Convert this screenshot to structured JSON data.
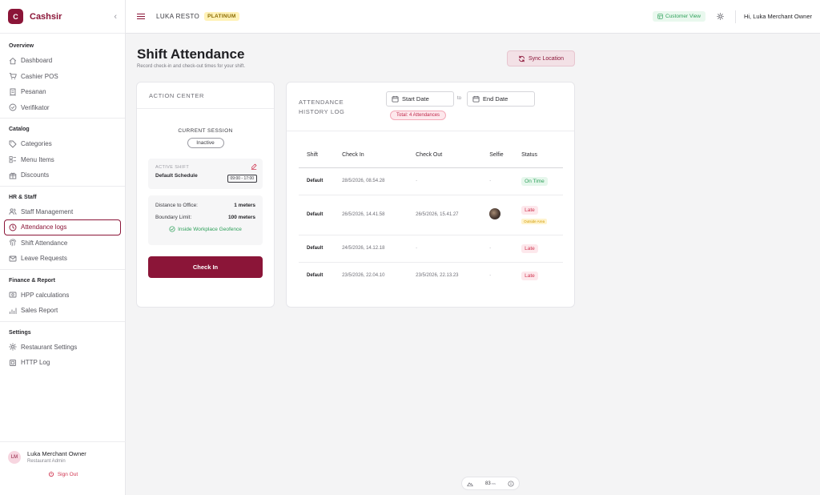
{
  "brand": {
    "logo_letter": "C",
    "name": "Cashsir"
  },
  "sidebar": {
    "sections": [
      {
        "title": "Overview",
        "items": [
          {
            "label": "Dashboard",
            "icon": "home-icon"
          },
          {
            "label": "Cashier POS",
            "icon": "cart-icon"
          },
          {
            "label": "Pesanan",
            "icon": "receipt-icon"
          },
          {
            "label": "Verifikator",
            "icon": "check-circle-icon"
          }
        ]
      },
      {
        "title": "Catalog",
        "items": [
          {
            "label": "Categories",
            "icon": "tag-icon"
          },
          {
            "label": "Menu Items",
            "icon": "menu-icon"
          },
          {
            "label": "Discounts",
            "icon": "gift-icon"
          }
        ]
      },
      {
        "title": "HR & Staff",
        "items": [
          {
            "label": "Staff Management",
            "icon": "users-icon"
          },
          {
            "label": "Attendance logs",
            "icon": "clock-icon",
            "active": true
          },
          {
            "label": "Shift Attendance",
            "icon": "fingerprint-icon"
          },
          {
            "label": "Leave Requests",
            "icon": "mail-icon"
          }
        ]
      },
      {
        "title": "Finance & Report",
        "items": [
          {
            "label": "HPP calculations",
            "icon": "calculator-icon"
          },
          {
            "label": "Sales Report",
            "icon": "bar-chart-icon"
          }
        ]
      },
      {
        "title": "Settings",
        "items": [
          {
            "label": "Restaurant Settings",
            "icon": "gear-icon"
          },
          {
            "label": "HTTP Log",
            "icon": "chip-icon"
          }
        ]
      }
    ],
    "user": {
      "initials": "LM",
      "name": "Luka Merchant Owner",
      "role": "Restaurant Admin"
    },
    "sign_out": "Sign Out"
  },
  "topbar": {
    "restaurant": "LUKA RESTO",
    "tier": "PLATINUM",
    "customer_view": "Customer View",
    "greeting": "Hi, Luka Merchant Owner"
  },
  "page": {
    "title": "Shift Attendance",
    "subtitle": "Record check-in and check-out times for your shift.",
    "sync_button": "Sync Location"
  },
  "action_center": {
    "title": "ACTION CENTER",
    "session_label": "CURRENT SESSION",
    "session_status": "Inactive",
    "active_shift_label": "ACTIVE SHIFT",
    "shift_name": "Default Schedule",
    "shift_time": "09:00 - 17:00",
    "distance_label": "Distance to Office:",
    "distance_value": "1 meters",
    "boundary_label": "Boundary Limit:",
    "boundary_value": "100 meters",
    "geofence_status": "Inside Workplace Geofence",
    "checkin_button": "Check In"
  },
  "history": {
    "title": "ATTENDANCE HISTORY LOG",
    "start_date": "Start Date",
    "to": "to",
    "end_date": "End Date",
    "total": "Total: 4 Attendances",
    "columns": [
      "Shift",
      "Check In",
      "Check Out",
      "Selfie",
      "Status"
    ],
    "rows": [
      {
        "shift": "Default",
        "check_in": "28/5/2026, 08.54.28",
        "check_out": "-",
        "selfie": "-",
        "status": "On Time",
        "note": ""
      },
      {
        "shift": "Default",
        "check_in": "26/5/2026, 14.41.58",
        "check_out": "26/5/2026, 15.41.27",
        "selfie": "photo",
        "status": "Late",
        "note": "Outside Area"
      },
      {
        "shift": "Default",
        "check_in": "24/5/2026, 14.12.18",
        "check_out": "-",
        "selfie": "-",
        "status": "Late",
        "note": ""
      },
      {
        "shift": "Default",
        "check_in": "23/5/2026, 22.04.10",
        "check_out": "23/5/2026, 22.13.23",
        "selfie": "-",
        "status": "Late",
        "note": ""
      }
    ]
  },
  "perf": {
    "value": "83",
    "unit": "ms"
  },
  "colors": {
    "brand": "#8b1538",
    "success": "#2ea05a",
    "danger": "#d0344f",
    "warning": "#d19a00"
  }
}
